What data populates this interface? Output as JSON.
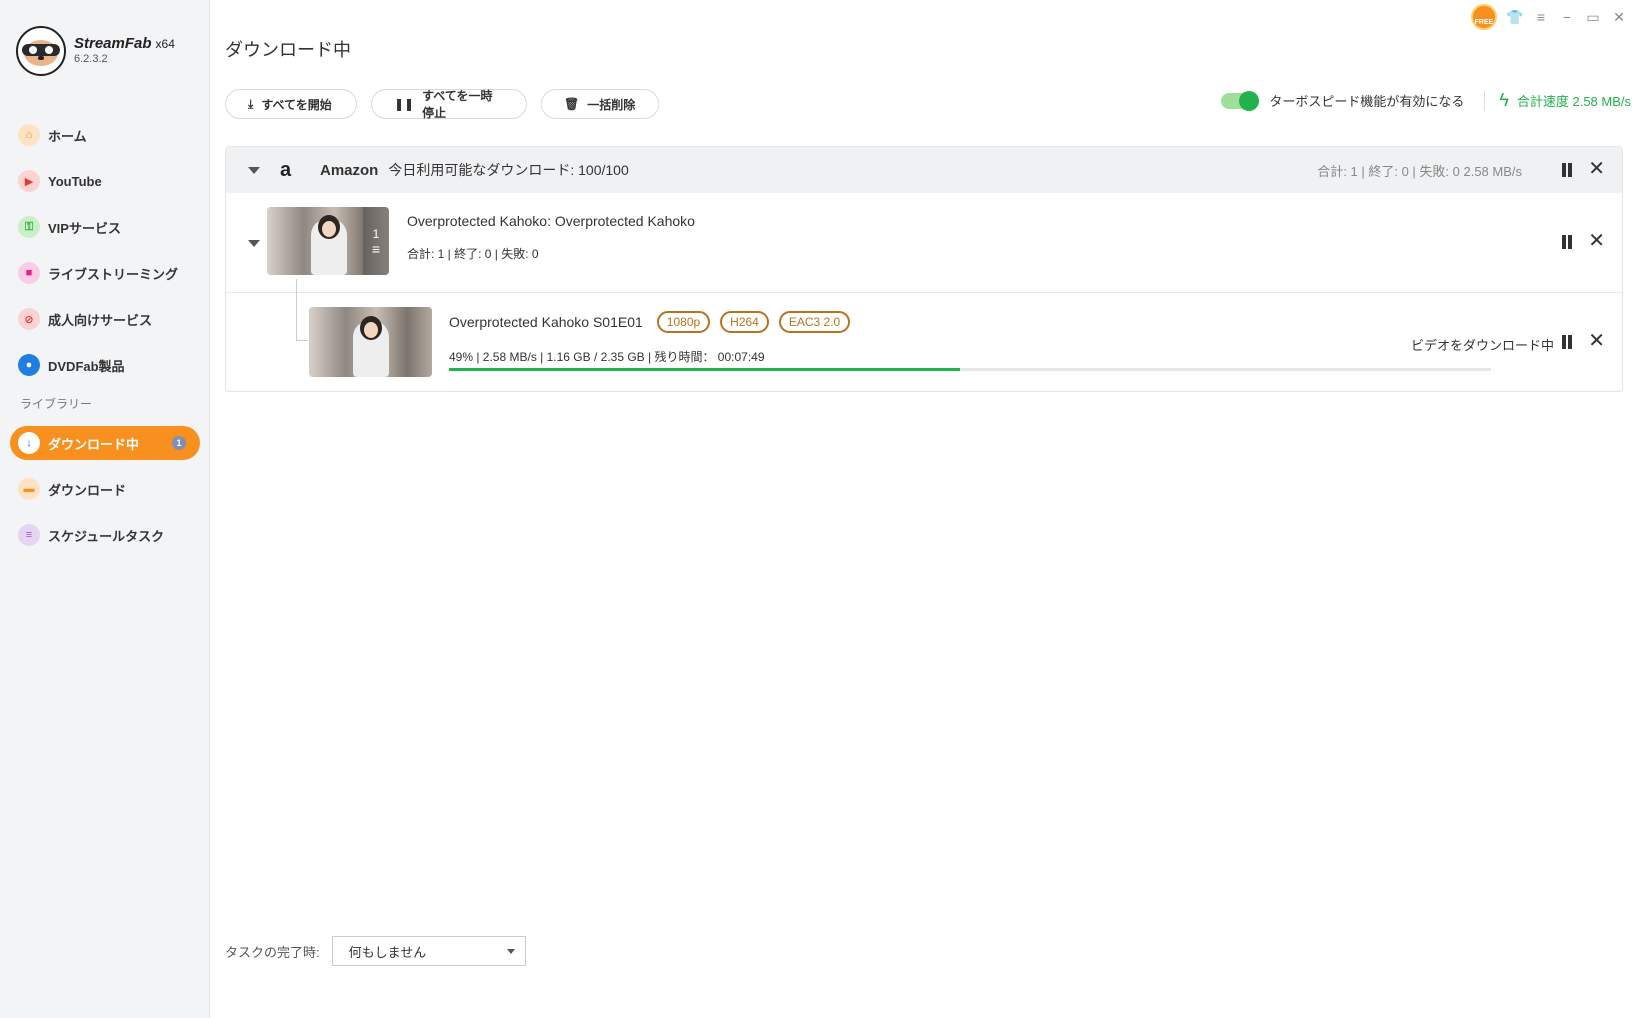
{
  "app": {
    "name": "StreamFab",
    "arch": "x64",
    "version": "6.2.3.2",
    "free_badge": "FREE"
  },
  "sidebar": {
    "items": [
      {
        "label": "ホーム",
        "icon": "home-icon",
        "color": "#f7901e"
      },
      {
        "label": "YouTube",
        "icon": "youtube-icon",
        "color": "#e53935"
      },
      {
        "label": "VIPサービス",
        "icon": "key-icon",
        "color": "#3cb043"
      },
      {
        "label": "ライブストリーミング",
        "icon": "camera-icon",
        "color": "#e91e8c"
      },
      {
        "label": "成人向けサービス",
        "icon": "adult-icon",
        "color": "#e53935"
      },
      {
        "label": "DVDFab製品",
        "icon": "dvdfab-icon",
        "color": "#1e7fe0"
      }
    ],
    "library_label": "ライブラリー",
    "library": [
      {
        "label": "ダウンロード中",
        "icon": "download-icon",
        "active": true,
        "badge": "1"
      },
      {
        "label": "ダウンロード",
        "icon": "folder-icon",
        "color": "#f7901e"
      },
      {
        "label": "スケジュールタスク",
        "icon": "schedule-icon",
        "color": "#9c59d1"
      }
    ]
  },
  "page": {
    "title": "ダウンロード中",
    "toolbar": {
      "start_all": "すべてを開始",
      "pause_all": "すべてを一時停止",
      "delete_all": "一括削除"
    },
    "turbo_label": "ターボスピード機能が有効になる",
    "total_speed": "合計速度 2.58 MB/s"
  },
  "group": {
    "service": "Amazon",
    "quota": "今日利用可能なダウンロード: 100/100",
    "stats": "合計: 1 | 終了: 0 | 失敗: 0   2.58 MB/s",
    "series": {
      "title": "Overprotected Kahoko: Overprotected Kahoko",
      "count": "1",
      "stats": "合計: 1 | 終了: 0 | 失敗: 0"
    },
    "episode": {
      "title": "Overprotected Kahoko S01E01",
      "tags": [
        "1080p",
        "H264",
        "EAC3 2.0"
      ],
      "stats": "49% | 2.58 MB/s | 1.16 GB / 2.35 GB | 残り時間： 00:07:49",
      "progress": 0.49,
      "status": "ビデオをダウンロード中"
    }
  },
  "footer": {
    "label": "タスクの完了時:",
    "select_value": "何もしません"
  }
}
